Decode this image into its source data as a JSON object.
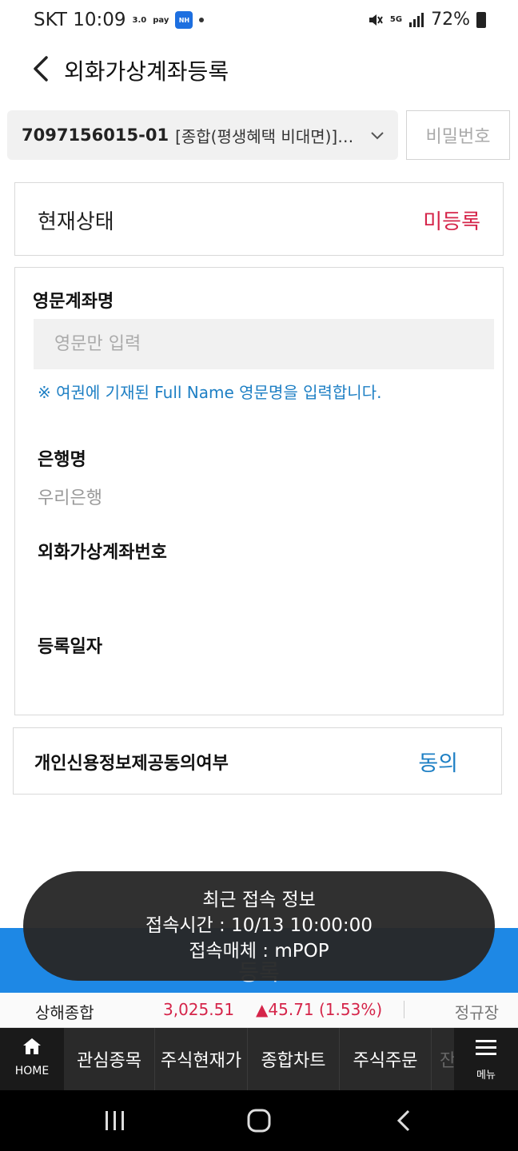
{
  "status_bar": {
    "carrier_time": "SKT 10:09",
    "icon_dx": "3.0",
    "icon_pay": "pay",
    "icon_nh": "NH",
    "network": "5G",
    "battery": "72%"
  },
  "header": {
    "title": "외화가상계좌등록"
  },
  "account": {
    "number": "7097156015-01",
    "name": "[종합(평생혜택 비대면)]…",
    "password_placeholder": "비밀번호"
  },
  "status": {
    "label": "현재상태",
    "value": "미등록"
  },
  "form": {
    "english_name_label": "영문계좌명",
    "english_name_placeholder": "영문만 입력",
    "notice": "※ 여권에 기재된 Full Name 영문명을 입력합니다.",
    "bank_label": "은행명",
    "bank_value": "우리은행",
    "virtual_account_label": "외화가상계좌번호",
    "register_date_label": "등록일자"
  },
  "consent": {
    "label": "개인신용정보제공동의여부",
    "value": "동의"
  },
  "register_button": {
    "label": "등록"
  },
  "toast": {
    "title": "최근 접속 정보",
    "time": "접속시간 : 10/13 10:00:00",
    "media": "접속매체 : mPOP"
  },
  "ticker": {
    "name": "상해종합",
    "price": "3,025.51",
    "change": "▲45.71 (1.53%)",
    "session": "정규장"
  },
  "bottom_nav": {
    "home": "HOME",
    "tabs": [
      "관심종목",
      "주식현재가",
      "종합차트",
      "주식주문",
      "잔"
    ],
    "menu": "메뉴"
  },
  "colors": {
    "accent_blue": "#1e88e5",
    "status_red": "#d5254a",
    "link_blue": "#1d7fc4"
  }
}
